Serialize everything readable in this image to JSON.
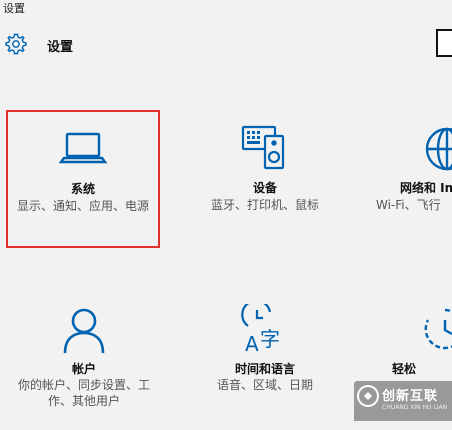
{
  "window": {
    "title": "设置"
  },
  "header": {
    "title": "设置"
  },
  "tiles": [
    {
      "label": "系统",
      "desc": "显示、通知、应用、电源",
      "icon": "laptop-icon"
    },
    {
      "label": "设备",
      "desc": "蓝牙、打印机、鼠标",
      "icon": "devices-icon"
    },
    {
      "label": "网络和 In",
      "desc": "Wi-Fi、飞行",
      "icon": "globe-icon"
    },
    {
      "label": "帐户",
      "desc": "你的帐户、同步设置、工作、其他用户",
      "icon": "person-icon"
    },
    {
      "label": "时间和语言",
      "desc": "语音、区域、日期",
      "icon": "time-language-icon"
    },
    {
      "label": "轻松",
      "desc": "",
      "icon": "ease-of-access-icon"
    }
  ],
  "watermark": {
    "text": "创新互联",
    "sub": "CHUANG XIN HU LIAN"
  },
  "colors": {
    "accent": "#0063b1",
    "selection_border": "#e0312f",
    "background": "#f2f2f2"
  }
}
